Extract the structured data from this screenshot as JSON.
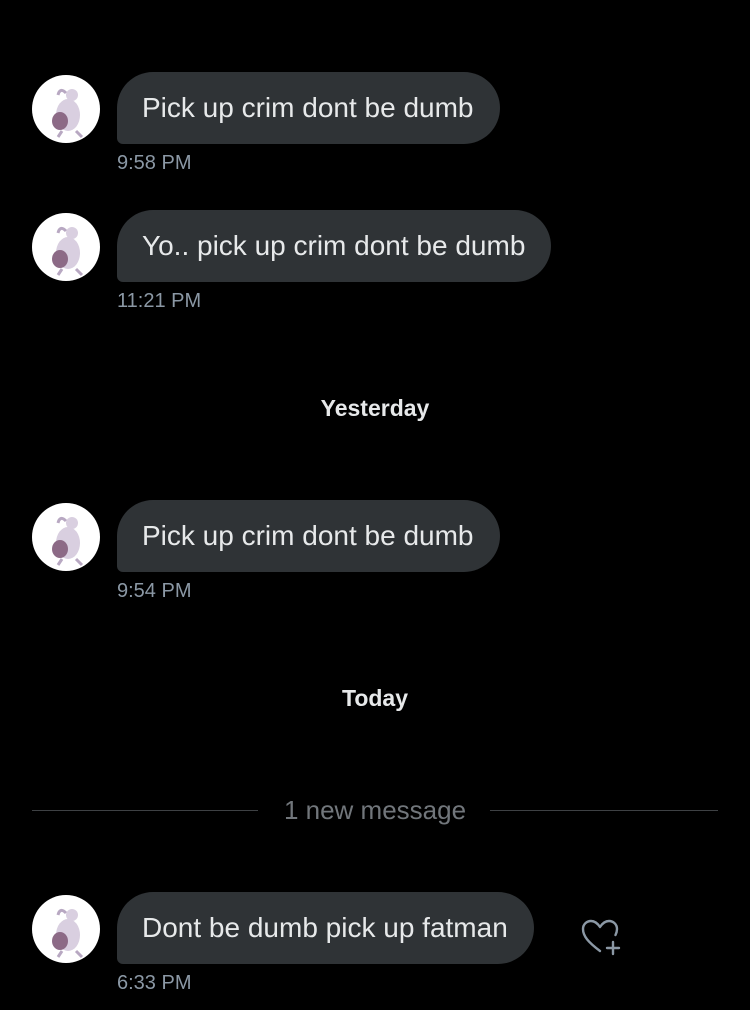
{
  "conversation": {
    "messages_1": [
      {
        "text": "Pick up crim dont be dumb",
        "time": "9:58 PM"
      },
      {
        "text": "Yo.. pick up crim dont be dumb",
        "time": "11:21 PM"
      }
    ],
    "separator_yesterday": "Yesterday",
    "messages_2": [
      {
        "text": "Pick up crim dont be dumb",
        "time": "9:54 PM"
      }
    ],
    "separator_today": "Today",
    "new_message_divider": "1 new message",
    "messages_3": [
      {
        "text": "Dont be dumb pick up fatman",
        "time": "6:33 PM"
      }
    ]
  },
  "icons": {
    "avatar": "mewtwo-avatar-icon",
    "reaction": "heart-plus-icon"
  },
  "colors": {
    "background": "#000000",
    "bubble": "#2f3336",
    "text": "#e7e9ea",
    "timestamp": "#8b98a5",
    "divider": "#3e4144"
  }
}
